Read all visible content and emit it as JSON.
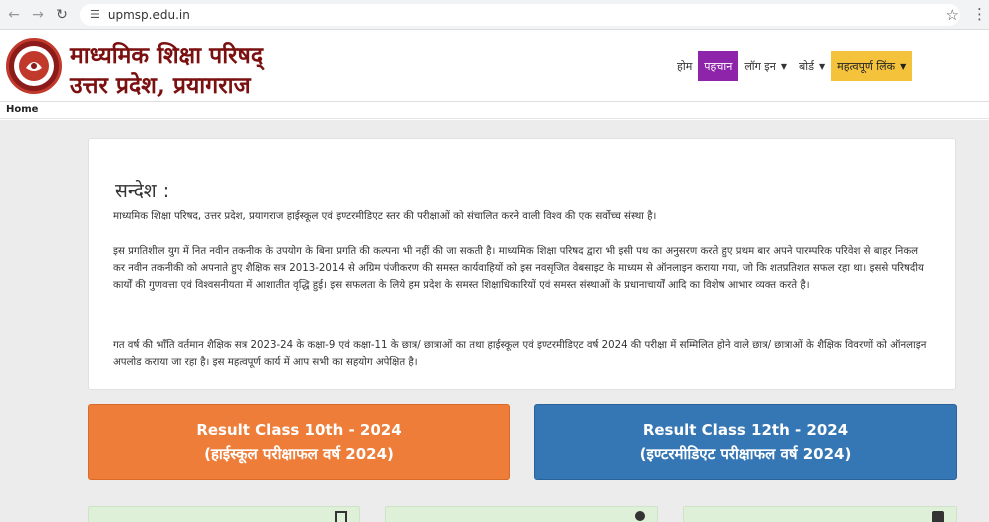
{
  "browser": {
    "url": "upmsp.edu.in"
  },
  "site": {
    "title_line1": "माध्यमिक शिक्षा परिषद्",
    "title_line2": "उत्तर प्रदेश, प्रयागराज"
  },
  "nav": {
    "home": "होम",
    "identity": "पहचान",
    "login": "लॉग इन",
    "board": "बोर्ड",
    "important_links": "महत्वपूर्ण लिंक"
  },
  "breadcrumb": "Home",
  "message": {
    "heading": "सन्देश :",
    "p1": "माध्यमिक शिक्षा परिषद, उत्तर प्रदेश, प्रयागराज हाईस्कूल एवं इण्टरमीडिएट स्तर की परीक्षाओं को संचालित करने वाली विश्व की एक सर्वोच्च संस्था है।",
    "p2": "इस प्रगतिशील युग में नित नवीन तकनीक के उपयोग के बिना प्रगति की कल्पना भी नहीं की जा सकती है। माध्यमिक शिक्षा परिषद द्वारा भी इसी पथ का अनुसरण करते हुए प्रथम बार अपने पारम्परिक परिवेश से बाहर निकल कर नवीन तकनीकी को अपनाते हुए शैक्षिक सत्र 2013-2014 से अग्रिम पंजीकरण की समस्त कार्यवाहियों को इस नवसृजित वेबसाइट के माध्यम से ऑनलाइन कराया गया, जो कि शतप्रतिशत सफल रहा था। इससे परिषदीय कार्यों की गुणवत्ता एवं विश्वसनीयता में आशातीत वृद्धि हुई। इस सफलता के लिये हम प्रदेश के समस्त शिक्षाधिकारियों एवं समस्त संस्थाओं के प्रधानाचार्यों आदि का विशेष आभार व्यक्त करते है।",
    "p3": "गत वर्ष की भाँति वर्तमान शैक्षिक सत्र 2023-24 के कक्षा-9 एवं कक्षा-11 के छात्र/ छात्राओं का तथा हाईस्कूल एवं इण्टरमीडिएट वर्ष 2024 की परीक्षा में सम्मिलित होने वाले छात्र/ छात्राओं के शैक्षिक विवरणों को ऑनलाइन अपलोड कराया जा रहा है। इस महत्वपूर्ण कार्य में आप सभी का सहयोग अपेक्षित है।"
  },
  "results": {
    "class10_line1": "Result Class 10th - 2024",
    "class10_line2": "(हाईस्कूल परीक्षाफल वर्ष 2024)",
    "class12_line1": "Result Class 12th - 2024",
    "class12_line2": "(इण्टरमीडिएट परीक्षाफल वर्ष 2024)"
  },
  "colors": {
    "brand": "#7a1010",
    "identity_active": "#8e24aa",
    "links_highlight": "#f4c23b",
    "result10": "#ed7d39",
    "result12": "#3576b4"
  }
}
